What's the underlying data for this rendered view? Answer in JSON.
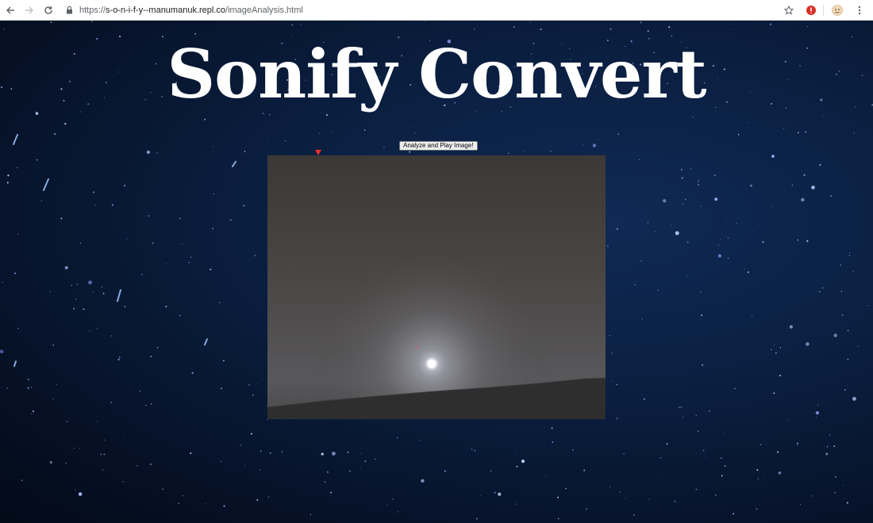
{
  "browser": {
    "url_scheme": "https://",
    "url_host": "s-o-n-i-f-y--manumanuk.repl.co",
    "url_path": "/imageAnalysis.html"
  },
  "page": {
    "title": "Sonify Convert",
    "analyze_button_label": "Analyze and Play Image!"
  },
  "image": {
    "description_icon": "sunset-photo"
  },
  "colors": {
    "background": "#0a1d3d",
    "marker": "#e8322a",
    "title": "#ffffff"
  }
}
